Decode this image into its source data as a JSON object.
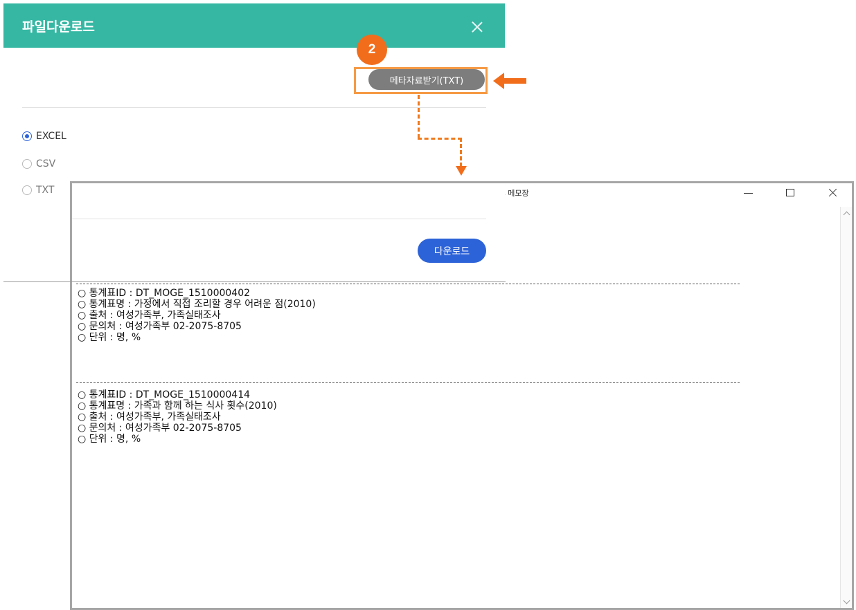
{
  "dialog": {
    "title": "파일다운로드",
    "step_badge": "2",
    "meta_button": "메타자료받기(TXT)",
    "formats": [
      {
        "label": "EXCEL",
        "checked": true
      },
      {
        "label": "CSV",
        "checked": false
      },
      {
        "label": "TXT",
        "checked": false
      }
    ],
    "download_button": "다운로드"
  },
  "notepad": {
    "title": "s 메모장",
    "separator": "------------------------------------------------------------------------------------------------------------------------------------------------------------------------------------------------------------",
    "blocks": [
      {
        "lines": [
          "○ 통계표ID : DT_MOGE_1510000402",
          "○ 통계표명 : 가정에서 직접 조리할 경우 어려운 점(2010)",
          "○ 출처 : 여성가족부, 가족실태조사",
          "○ 문의처 : 여성가족부 02-2075-8705",
          "○ 단위 : 명, %"
        ]
      },
      {
        "lines": [
          "○ 통계표ID : DT_MOGE_1510000414",
          "○ 통계표명 : 가족과 함께 하는 식사 횟수(2010)",
          "○ 출처 : 여성가족부, 가족실태조사",
          "○ 문의처 : 여성가족부 02-2075-8705",
          "○ 단위 : 명, %"
        ]
      }
    ]
  },
  "colors": {
    "header": "#35b7a3",
    "accent_orange": "#f26d1b",
    "primary_blue": "#2d63d8",
    "meta_button_gray": "#7d7d7d"
  }
}
